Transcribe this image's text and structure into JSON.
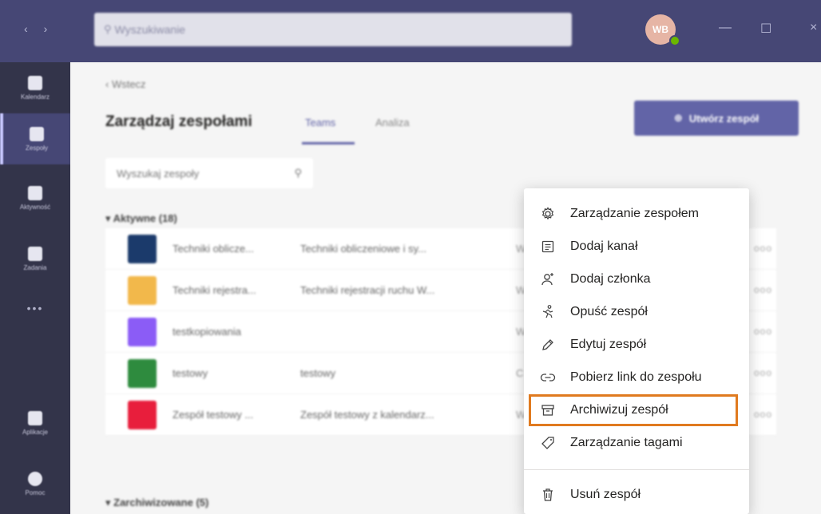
{
  "titlebar": {
    "search_placeholder": "Wyszukiwanie",
    "avatar_initials": "WB"
  },
  "rail": {
    "items": [
      {
        "label": "Kalendarz",
        "icon": "calendar-icon"
      },
      {
        "label": "Zespoły",
        "icon": "teams-icon",
        "active": true
      },
      {
        "label": "Aktywność",
        "icon": "bell-icon"
      },
      {
        "label": "Zadania",
        "icon": "tasks-icon"
      }
    ],
    "more": "•••",
    "apps_label": "Aplikacje",
    "help_label": "Pomoc"
  },
  "main": {
    "back_label": "‹  Wstecz",
    "title": "Zarządzaj zespołami",
    "tabs": [
      {
        "label": "Teams"
      },
      {
        "label": "Analiza"
      }
    ],
    "create_button": "Utwórz zespół",
    "team_search_placeholder": "Wyszukaj zespoły",
    "active_section": "Aktywne (18)",
    "archived_section": "Zarchiwizowane (5)",
    "rows": [
      {
        "name": "Techniki oblicze...",
        "desc": "Techniki obliczeniowe i sy...",
        "col3": "W",
        "dots": "ooo",
        "color": "#1b3a6b"
      },
      {
        "name": "Techniki rejestra...",
        "desc": "Techniki rejestracji ruchu W...",
        "col3": "W",
        "dots": "ooo",
        "color": "#f2b84b"
      },
      {
        "name": "testkopiowania",
        "desc": "",
        "col3": "W",
        "dots": "ooo",
        "color": "#8b5cf6"
      },
      {
        "name": "testowy",
        "desc": "testowy",
        "col3": "C",
        "dots": "ooo",
        "color": "#2e8b3e"
      },
      {
        "name": "Zespół testowy ...",
        "desc": "Zespół testowy z kalendarz...",
        "col3": "W",
        "dots": "ooo",
        "color": "#e81e3c"
      }
    ]
  },
  "menu": {
    "items": [
      {
        "label": "Zarządzanie zespołem",
        "icon": "gear-icon"
      },
      {
        "label": "Dodaj kanał",
        "icon": "channel-icon"
      },
      {
        "label": "Dodaj członka",
        "icon": "add-member-icon"
      },
      {
        "label": "Opuść zespół",
        "icon": "leave-icon"
      },
      {
        "label": "Edytuj zespół",
        "icon": "pencil-icon"
      },
      {
        "label": "Pobierz link do zespołu",
        "icon": "link-icon"
      },
      {
        "label": "Archiwizuj zespół",
        "icon": "archive-icon",
        "highlighted": true
      },
      {
        "label": "Zarządzanie tagami",
        "icon": "tag-icon"
      },
      {
        "label": "Usuń zespół",
        "icon": "trash-icon"
      }
    ],
    "highlight_color": "#e07a1f"
  }
}
